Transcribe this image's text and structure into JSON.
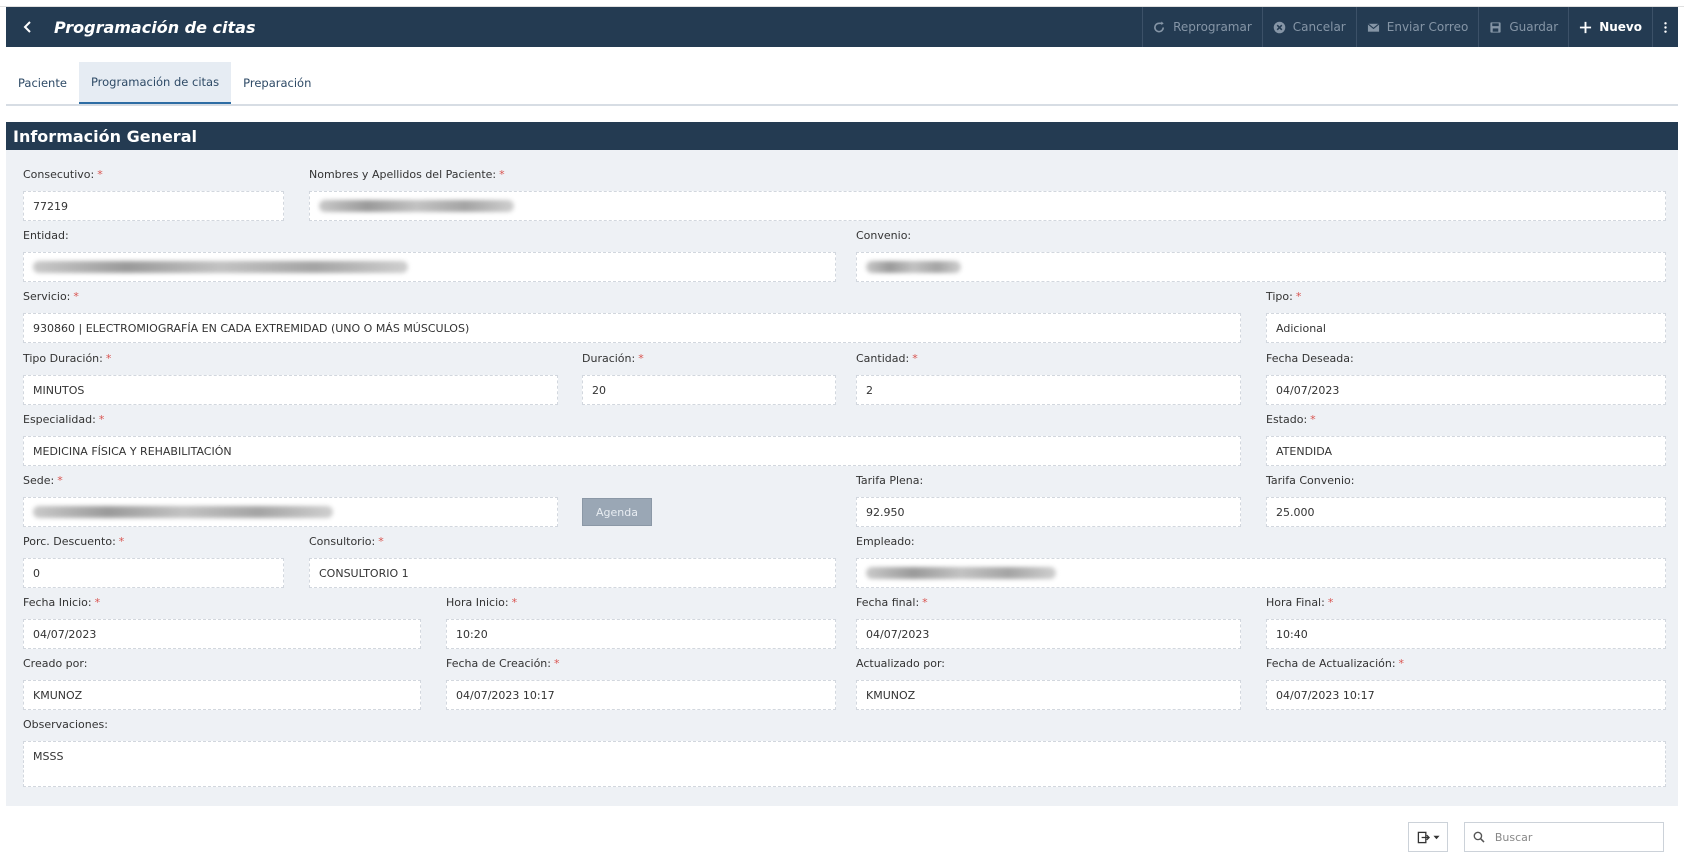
{
  "header": {
    "title": "Programación de citas",
    "buttons": {
      "reprogramar": "Reprogramar",
      "cancelar": "Cancelar",
      "enviar_correo": "Enviar Correo",
      "guardar": "Guardar",
      "nuevo": "Nuevo"
    }
  },
  "tabs": [
    {
      "label": "Paciente",
      "active": false
    },
    {
      "label": "Programación de citas",
      "active": true
    },
    {
      "label": "Preparación",
      "active": false
    }
  ],
  "section": {
    "title": "Información General"
  },
  "form": {
    "consecutivo": {
      "label": "Consecutivo:",
      "value": "77219"
    },
    "paciente": {
      "label": "Nombres y Apellidos del Paciente:",
      "value": ""
    },
    "entidad": {
      "label": "Entidad:",
      "value": ""
    },
    "convenio": {
      "label": "Convenio:",
      "value": ""
    },
    "servicio": {
      "label": "Servicio:",
      "value": "930860 | ELECTROMIOGRAFÍA EN CADA EXTREMIDAD (UNO O MÁS MÚSCULOS)"
    },
    "tipo": {
      "label": "Tipo:",
      "value": "Adicional"
    },
    "tipo_duracion": {
      "label": "Tipo Duración:",
      "value": "MINUTOS"
    },
    "duracion": {
      "label": "Duración:",
      "value": "20"
    },
    "cantidad": {
      "label": "Cantidad:",
      "value": "2"
    },
    "fecha_deseada": {
      "label": "Fecha Deseada:",
      "value": "04/07/2023"
    },
    "especialidad": {
      "label": "Especialidad:",
      "value": "MEDICINA FÍSICA Y REHABILITACIÓN"
    },
    "estado": {
      "label": "Estado:",
      "value": "ATENDIDA"
    },
    "sede": {
      "label": "Sede:",
      "value": ""
    },
    "agenda_button": "Agenda",
    "tarifa_plena": {
      "label": "Tarifa Plena:",
      "value": "92.950"
    },
    "tarifa_convenio": {
      "label": "Tarifa Convenio:",
      "value": "25.000"
    },
    "porc_descuento": {
      "label": "Porc. Descuento:",
      "value": "0"
    },
    "consultorio": {
      "label": "Consultorio:",
      "value": "CONSULTORIO 1"
    },
    "empleado": {
      "label": "Empleado:",
      "value": ""
    },
    "fecha_inicio": {
      "label": "Fecha Inicio:",
      "value": "04/07/2023"
    },
    "hora_inicio": {
      "label": "Hora Inicio:",
      "value": "10:20"
    },
    "fecha_final": {
      "label": "Fecha final:",
      "value": "04/07/2023"
    },
    "hora_final": {
      "label": "Hora Final:",
      "value": "10:40"
    },
    "creado_por": {
      "label": "Creado por:",
      "value": "KMUNOZ"
    },
    "fecha_creacion": {
      "label": "Fecha de Creación:",
      "value": "04/07/2023 10:17"
    },
    "actualizado_por": {
      "label": "Actualizado por:",
      "value": "KMUNOZ"
    },
    "fecha_actualizacion": {
      "label": "Fecha de Actualización:",
      "value": "04/07/2023 10:17"
    },
    "observaciones": {
      "label": "Observaciones:",
      "value": "MSSS"
    }
  },
  "footer": {
    "search_placeholder": "Buscar"
  },
  "colors": {
    "header_bg": "#243b52",
    "panel_bg": "#eef1f5",
    "required": "#d9534f"
  }
}
